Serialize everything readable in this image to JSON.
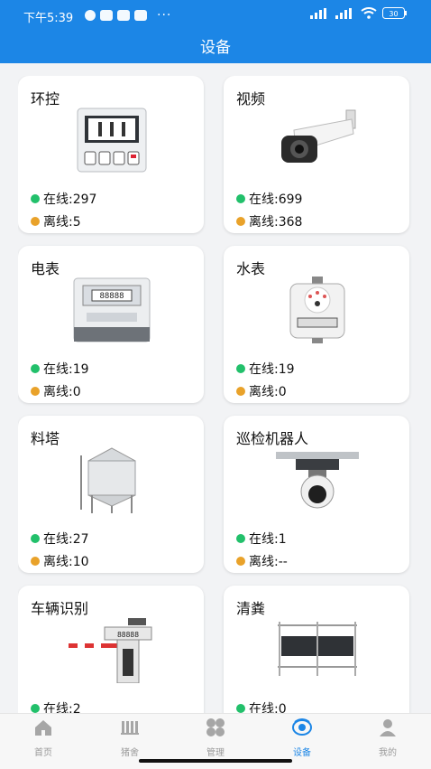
{
  "status_bar": {
    "time": "下午5:39",
    "battery": "30"
  },
  "header": {
    "title": "设备"
  },
  "devices": [
    {
      "name": "环控",
      "online": "在线:297",
      "offline": "离线:5"
    },
    {
      "name": "视频",
      "online": "在线:699",
      "offline": "离线:368"
    },
    {
      "name": "电表",
      "online": "在线:19",
      "offline": "离线:0"
    },
    {
      "name": "水表",
      "online": "在线:19",
      "offline": "离线:0"
    },
    {
      "name": "料塔",
      "online": "在线:27",
      "offline": "离线:10"
    },
    {
      "name": "巡检机器人",
      "online": "在线:1",
      "offline": "离线:--"
    },
    {
      "name": "车辆识别",
      "online": "在线:2",
      "offline": ""
    },
    {
      "name": "清粪",
      "online": "在线:0",
      "offline": ""
    }
  ],
  "tabbar": {
    "items": [
      {
        "label": "首页",
        "icon": "home-icon"
      },
      {
        "label": "猪舍",
        "icon": "barn-icon"
      },
      {
        "label": "管理",
        "icon": "grid-icon"
      },
      {
        "label": "设备",
        "icon": "device-icon",
        "active": true
      },
      {
        "label": "我的",
        "icon": "profile-icon"
      }
    ]
  },
  "colors": {
    "primary": "#1c86e6",
    "online": "#22c06b",
    "offline": "#e9a22a"
  }
}
